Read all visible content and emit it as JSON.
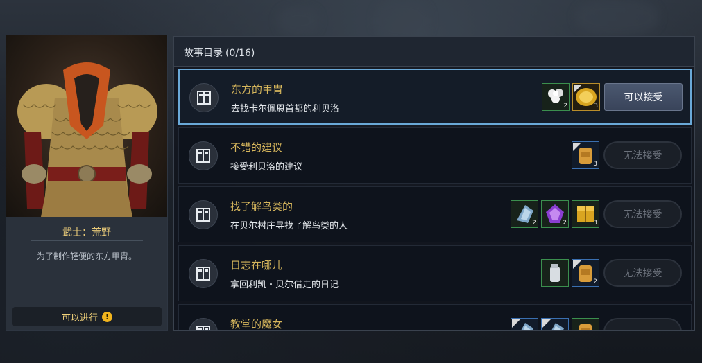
{
  "character_card": {
    "title": "武士：荒野",
    "description": "为了制作轻便的东方甲胄。",
    "status_label": "可以进行",
    "status_icon": "exclamation-icon"
  },
  "story_panel": {
    "title": "故事目录",
    "count": "(0/16)"
  },
  "quests": [
    {
      "name": "东方的甲胄",
      "description": "去找卡尔佩恩首都的利贝洛",
      "button": "可以接受",
      "available": true,
      "rewards": [
        {
          "icon": "cotton-icon",
          "qty": "2",
          "frame": "green"
        },
        {
          "icon": "gold-coin-icon",
          "qty": "3",
          "frame": "gold"
        }
      ]
    },
    {
      "name": "不错的建议",
      "description": "接受利贝洛的建议",
      "button": "无法接受",
      "available": false,
      "rewards": [
        {
          "icon": "backpack-icon",
          "qty": "3",
          "frame": "blue"
        }
      ]
    },
    {
      "name": "找了解鸟类的",
      "description": "在贝尔村庄寻找了解鸟类的人",
      "button": "无法接受",
      "available": false,
      "rewards": [
        {
          "icon": "blue-crystal-icon",
          "qty": "2",
          "frame": "green"
        },
        {
          "icon": "purple-gem-icon",
          "qty": "2",
          "frame": "green"
        },
        {
          "icon": "gold-box-icon",
          "qty": "3",
          "frame": "green"
        }
      ]
    },
    {
      "name": "日志在哪儿",
      "description": "拿回利凯・贝尔借走的日记",
      "button": "无法接受",
      "available": false,
      "rewards": [
        {
          "icon": "milk-can-icon",
          "qty": "",
          "frame": "green"
        },
        {
          "icon": "backpack-icon",
          "qty": "2",
          "frame": "blue"
        }
      ]
    },
    {
      "name": "教堂的魔女",
      "description": "",
      "button": "",
      "available": false,
      "rewards": [
        {
          "icon": "blue-crystal-icon",
          "qty": "",
          "frame": "blue"
        },
        {
          "icon": "blue-crystal-icon",
          "qty": "",
          "frame": "blue"
        },
        {
          "icon": "backpack-icon",
          "qty": "",
          "frame": "green"
        }
      ]
    }
  ]
}
